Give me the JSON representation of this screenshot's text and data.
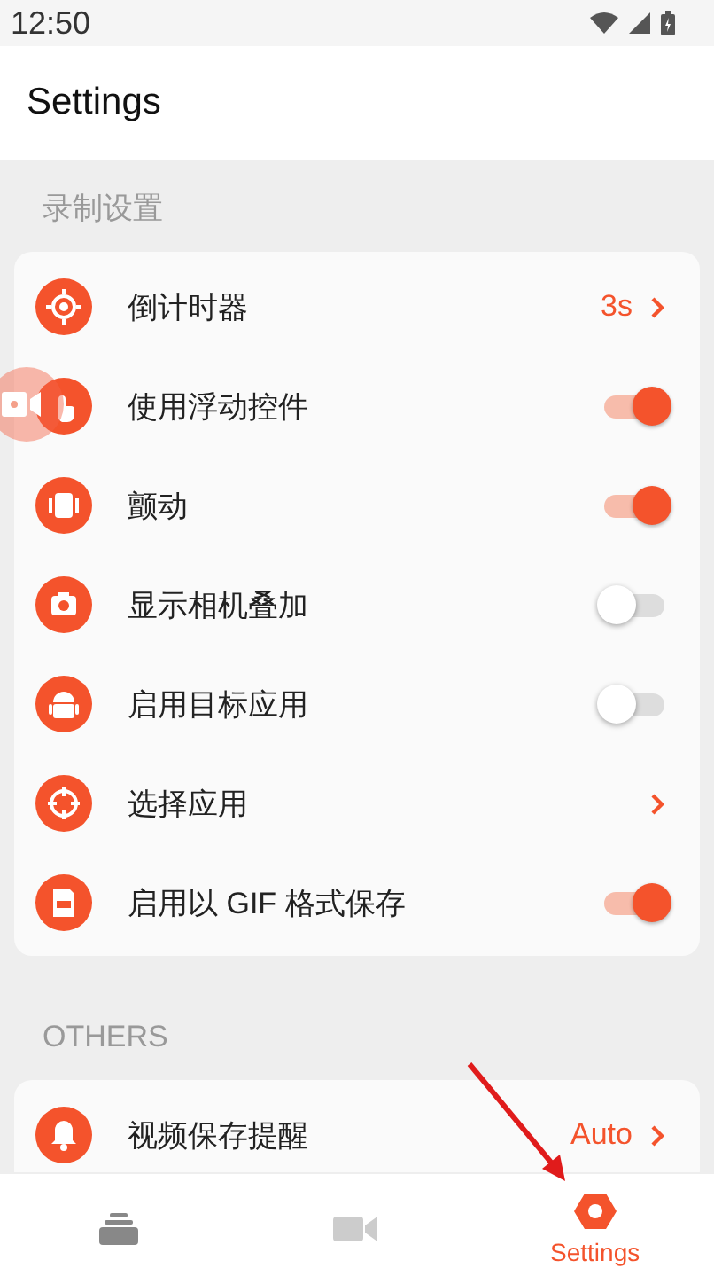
{
  "status_bar": {
    "time": "12:50"
  },
  "app_bar": {
    "title": "Settings"
  },
  "sections": [
    {
      "title": "录制设置",
      "items": [
        {
          "kind": "link",
          "label": "倒计时器",
          "value": "3s"
        },
        {
          "kind": "toggle",
          "label": "使用浮动控件",
          "on": true
        },
        {
          "kind": "toggle",
          "label": "颤动",
          "on": true
        },
        {
          "kind": "toggle",
          "label": "显示相机叠加",
          "on": false
        },
        {
          "kind": "toggle",
          "label": "启用目标应用",
          "on": false
        },
        {
          "kind": "link",
          "label": "选择应用"
        },
        {
          "kind": "toggle",
          "label": "启用以 GIF 格式保存",
          "on": true
        }
      ]
    },
    {
      "title": "OTHERS",
      "items": [
        {
          "kind": "link",
          "label": "视频保存提醒",
          "value": "Auto"
        }
      ]
    }
  ],
  "bottom_nav": [
    {
      "selected": false
    },
    {
      "selected": false
    },
    {
      "label": "Settings",
      "selected": true
    }
  ]
}
